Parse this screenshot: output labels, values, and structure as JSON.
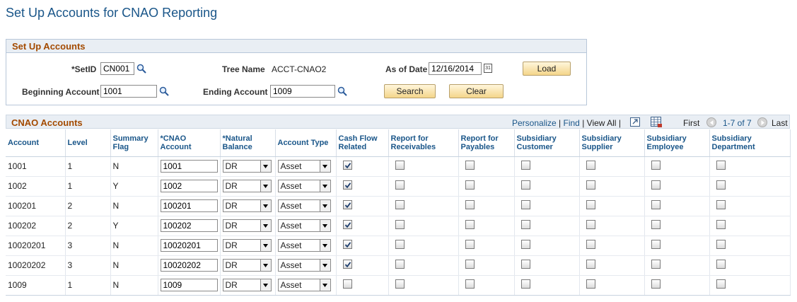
{
  "page": {
    "title": "Set Up Accounts for CNAO Reporting"
  },
  "setup": {
    "header": "Set Up Accounts",
    "setid_label": "*SetID",
    "setid_value": "CN001",
    "tree_label": "Tree Name",
    "tree_value": "ACCT-CNAO2",
    "asof_label": "As of Date",
    "asof_value": "12/16/2014",
    "load_label": "Load",
    "begin_label": "Beginning Account",
    "begin_value": "1001",
    "end_label": "Ending Account",
    "end_value": "1009",
    "search_label": "Search",
    "clear_label": "Clear"
  },
  "grid": {
    "title": "CNAO Accounts",
    "personalize": "Personalize",
    "find": "Find",
    "view_all": "View All",
    "first": "First",
    "range": "1-7 of 7",
    "last": "Last",
    "columns": [
      "Account",
      "Level",
      "Summary Flag",
      "*CNAO Account",
      "*Natural Balance",
      "Account Type",
      "Cash Flow Related",
      "Report for Receivables",
      "Report for Payables",
      "Subsidiary Customer",
      "Subsidiary Supplier",
      "Subsidiary Employee",
      "Subsidiary Department"
    ],
    "rows": [
      {
        "account": "1001",
        "level": "1",
        "summary": "N",
        "cnao": "1001",
        "balance": "DR",
        "type": "Asset",
        "cash_flow": true
      },
      {
        "account": "1002",
        "level": "1",
        "summary": "Y",
        "cnao": "1002",
        "balance": "DR",
        "type": "Asset",
        "cash_flow": true
      },
      {
        "account": "100201",
        "level": "2",
        "summary": "N",
        "cnao": "100201",
        "balance": "DR",
        "type": "Asset",
        "cash_flow": true
      },
      {
        "account": "100202",
        "level": "2",
        "summary": "Y",
        "cnao": "100202",
        "balance": "DR",
        "type": "Asset",
        "cash_flow": true
      },
      {
        "account": "10020201",
        "level": "3",
        "summary": "N",
        "cnao": "10020201",
        "balance": "DR",
        "type": "Asset",
        "cash_flow": true
      },
      {
        "account": "10020202",
        "level": "3",
        "summary": "N",
        "cnao": "10020202",
        "balance": "DR",
        "type": "Asset",
        "cash_flow": true
      },
      {
        "account": "1009",
        "level": "1",
        "summary": "N",
        "cnao": "1009",
        "balance": "DR",
        "type": "Asset",
        "cash_flow": false
      }
    ]
  },
  "colors": {
    "title": "#1a5689",
    "section": "#a34a00",
    "header_bg": "#e9eef4"
  }
}
